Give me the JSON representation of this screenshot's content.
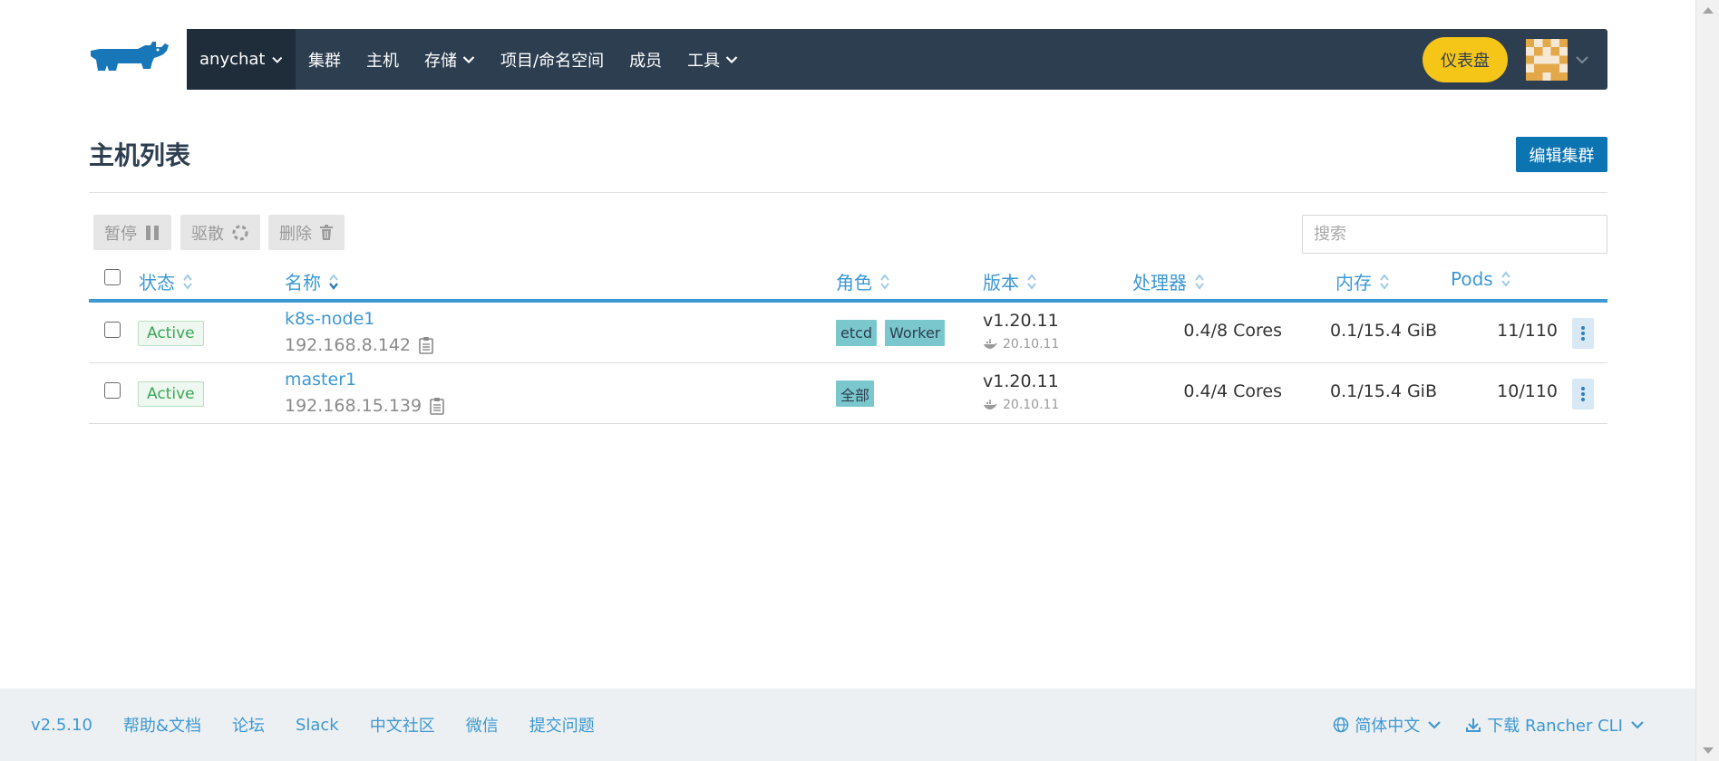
{
  "header": {
    "cluster_name": "anychat",
    "nav_items": [
      {
        "label": "集群",
        "has_dropdown": false
      },
      {
        "label": "主机",
        "has_dropdown": false
      },
      {
        "label": "存储",
        "has_dropdown": true
      },
      {
        "label": "项目/命名空间",
        "has_dropdown": false
      },
      {
        "label": "成员",
        "has_dropdown": false
      },
      {
        "label": "工具",
        "has_dropdown": true
      }
    ],
    "dashboard_label": "仪表盘",
    "brand_color": "#1877b8",
    "nav_bg": "#2d3e50"
  },
  "page": {
    "title": "主机列表",
    "edit_cluster_label": "编辑集群",
    "bulk_actions": {
      "pause": "暂停",
      "drain": "驱散",
      "delete": "删除"
    },
    "search_placeholder": "搜索"
  },
  "table": {
    "columns": {
      "state": "状态",
      "name": "名称",
      "roles": "角色",
      "version": "版本",
      "cpu": "处理器",
      "memory": "内存",
      "pods": "Pods"
    },
    "rows": [
      {
        "state": "Active",
        "name": "k8s-node1",
        "ip": "192.168.8.142",
        "roles": [
          "etcd",
          "Worker"
        ],
        "version": "v1.20.11",
        "docker_version": "20.10.11",
        "cpu": "0.4/8 Cores",
        "memory": "0.1/15.4 GiB",
        "pods": "11/110"
      },
      {
        "state": "Active",
        "name": "master1",
        "ip": "192.168.15.139",
        "roles": [
          "全部"
        ],
        "version": "v1.20.11",
        "docker_version": "20.10.11",
        "cpu": "0.4/4 Cores",
        "memory": "0.1/15.4 GiB",
        "pods": "10/110"
      }
    ]
  },
  "footer": {
    "version": "v2.5.10",
    "links": [
      "帮助&文档",
      "论坛",
      "Slack",
      "中文社区",
      "微信",
      "提交问题"
    ],
    "language": "简体中文",
    "download_cli": "下载 Rancher CLI"
  }
}
